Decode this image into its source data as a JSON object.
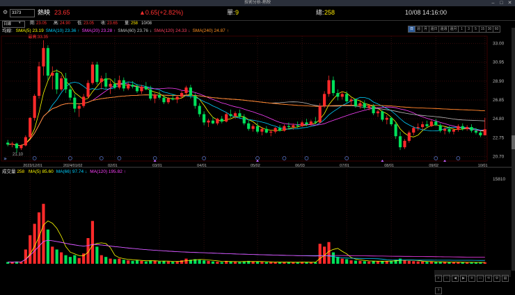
{
  "window": {
    "title": "技術分析-熱映",
    "min": "–",
    "max": "□",
    "close": "✕"
  },
  "info": {
    "code": "3373",
    "name": "熱映",
    "price": "23.65",
    "change": "▲0.65(+2.82%)",
    "unit_label": "單:",
    "unit_value": "9",
    "total_label": "總:",
    "total_value": "258",
    "datetime": "10/08 14:16:00"
  },
  "toolbar": {
    "period": "日線",
    "timeframes": [
      "日",
      "週",
      "月",
      "還日",
      "還週",
      "還月",
      "1",
      "3",
      "5",
      "15",
      "30",
      "60"
    ],
    "active_tf": 0
  },
  "ohlc": {
    "open_label": "開:",
    "open": "23.05",
    "high_label": "高:",
    "high": "24.90",
    "low_label": "低:",
    "low": "23.05",
    "close_label": "收:",
    "close": "23.65",
    "vol_label": "量:",
    "vol": "258",
    "date": "10/08"
  },
  "ma_legend": {
    "title": "均線:",
    "items": [
      {
        "label": "SMA(5) 23.19",
        "color": "#ffff00"
      },
      {
        "label": "SMA(10) 23.36 ↑",
        "color": "#00d0ff"
      },
      {
        "label": "SMA(20) 23.28 ↑",
        "color": "#ff40ff"
      },
      {
        "label": "SMA(60) 23.76 ↓",
        "color": "#c0c0c0"
      },
      {
        "label": "SMA(120) 24.33 ↓",
        "color": "#ff4060"
      },
      {
        "label": "SMA(240) 24.87 ↑",
        "color": "#ff9020"
      }
    ]
  },
  "annotations": {
    "max": "最高:33.35",
    "min": "21.10"
  },
  "vol_legend": {
    "title": "成交量",
    "value": "258",
    "items": [
      {
        "label": "MA(5) 85.60",
        "color": "#ffff00"
      },
      {
        "label": "MA(66) 97.74 ↓",
        "color": "#00d0ff"
      },
      {
        "label": "MA(120) 195.82 ↑",
        "color": "#ff40ff"
      }
    ]
  },
  "y_ticks": [
    "33.00",
    "30.95",
    "28.90",
    "26.85",
    "24.80",
    "22.75",
    "20.70"
  ],
  "x_ticks": [
    "2023/12/01",
    "2024/01/02",
    "02/01",
    "03/01",
    "04/01",
    "05/02",
    "06/03",
    "07/01",
    "08/01",
    "09/02",
    "10/01"
  ],
  "vol_max": "15810",
  "colors": {
    "up": "#ff2a2a",
    "down": "#00e05a",
    "bg": "#000000"
  },
  "chart_data": {
    "type": "candlestick",
    "y_range": [
      20.2,
      33.8
    ],
    "vol_range": [
      0,
      15810
    ],
    "candles": [
      [
        22.2,
        22.5,
        21.8,
        22.0,
        300
      ],
      [
        22.0,
        22.3,
        21.7,
        22.1,
        250
      ],
      [
        22.1,
        22.2,
        21.1,
        21.6,
        400
      ],
      [
        21.6,
        22.0,
        21.4,
        21.9,
        300
      ],
      [
        21.9,
        23.0,
        21.8,
        22.8,
        2500
      ],
      [
        22.8,
        25.0,
        22.7,
        24.9,
        5000
      ],
      [
        24.9,
        27.5,
        24.6,
        27.3,
        7000
      ],
      [
        27.3,
        31.0,
        27.0,
        30.5,
        9000
      ],
      [
        30.5,
        33.35,
        29.5,
        32.5,
        10500
      ],
      [
        32.5,
        32.8,
        29.0,
        29.5,
        6000
      ],
      [
        29.5,
        30.5,
        28.0,
        29.8,
        3000
      ],
      [
        29.8,
        30.2,
        27.5,
        28.0,
        2500
      ],
      [
        28.0,
        29.5,
        27.8,
        29.2,
        2000
      ],
      [
        29.2,
        29.8,
        27.6,
        28.0,
        1500
      ],
      [
        28.0,
        28.5,
        26.8,
        27.1,
        1200
      ],
      [
        27.1,
        27.5,
        25.5,
        25.9,
        1500
      ],
      [
        25.9,
        26.4,
        25.0,
        26.2,
        1000
      ],
      [
        26.2,
        27.5,
        26.0,
        27.2,
        1800
      ],
      [
        27.2,
        29.0,
        27.0,
        28.7,
        4500
      ],
      [
        28.7,
        31.0,
        28.5,
        30.7,
        7500
      ],
      [
        30.7,
        31.0,
        28.5,
        28.8,
        3000
      ],
      [
        28.8,
        29.5,
        28.0,
        29.2,
        1500
      ],
      [
        29.2,
        29.8,
        28.0,
        28.3,
        1200
      ],
      [
        28.3,
        29.0,
        27.5,
        28.6,
        900
      ],
      [
        28.6,
        29.2,
        28.0,
        28.2,
        800
      ],
      [
        28.2,
        29.5,
        28.0,
        29.0,
        900
      ],
      [
        29.0,
        29.3,
        27.8,
        28.1,
        700
      ],
      [
        28.1,
        28.8,
        27.9,
        28.5,
        600
      ],
      [
        28.5,
        28.9,
        28.1,
        28.3,
        500
      ],
      [
        28.3,
        28.6,
        27.6,
        27.8,
        600
      ],
      [
        27.8,
        28.5,
        27.5,
        28.3,
        500
      ],
      [
        28.3,
        28.8,
        27.9,
        28.0,
        400
      ],
      [
        28.0,
        28.4,
        26.8,
        27.0,
        600
      ],
      [
        27.0,
        27.6,
        26.5,
        27.4,
        500
      ],
      [
        27.4,
        27.8,
        26.9,
        27.1,
        400
      ],
      [
        27.1,
        27.4,
        26.4,
        26.6,
        500
      ],
      [
        26.6,
        27.2,
        26.4,
        27.0,
        400
      ],
      [
        27.0,
        27.5,
        26.8,
        26.9,
        350
      ],
      [
        26.9,
        27.3,
        26.5,
        27.2,
        400
      ],
      [
        27.2,
        27.8,
        27.0,
        27.6,
        600
      ],
      [
        27.6,
        28.4,
        27.4,
        28.2,
        900
      ],
      [
        28.2,
        28.5,
        27.0,
        27.3,
        700
      ],
      [
        27.3,
        27.6,
        25.9,
        26.2,
        800
      ],
      [
        26.2,
        26.5,
        25.0,
        25.3,
        700
      ],
      [
        25.3,
        25.6,
        24.1,
        24.4,
        600
      ],
      [
        24.4,
        24.8,
        23.9,
        24.6,
        500
      ],
      [
        24.6,
        25.0,
        24.2,
        24.3,
        400
      ],
      [
        24.3,
        24.9,
        24.1,
        24.8,
        350
      ],
      [
        24.8,
        25.1,
        24.3,
        24.5,
        300
      ],
      [
        24.5,
        25.5,
        24.4,
        25.3,
        500
      ],
      [
        25.3,
        25.8,
        24.9,
        25.1,
        400
      ],
      [
        25.1,
        25.6,
        24.8,
        25.4,
        350
      ],
      [
        25.4,
        25.8,
        24.9,
        25.0,
        300
      ],
      [
        25.0,
        25.3,
        24.1,
        24.3,
        400
      ],
      [
        24.3,
        24.7,
        23.5,
        23.7,
        500
      ],
      [
        23.7,
        24.2,
        23.4,
        24.0,
        400
      ],
      [
        24.0,
        24.4,
        23.2,
        23.4,
        350
      ],
      [
        23.4,
        23.9,
        23.0,
        23.7,
        300
      ],
      [
        23.7,
        24.0,
        23.2,
        23.3,
        280
      ],
      [
        23.3,
        23.6,
        22.9,
        23.4,
        300
      ],
      [
        23.4,
        23.9,
        23.2,
        23.8,
        260
      ],
      [
        23.8,
        24.1,
        23.4,
        23.5,
        240
      ],
      [
        23.5,
        24.2,
        23.4,
        24.0,
        300
      ],
      [
        24.0,
        24.4,
        23.7,
        23.9,
        280
      ],
      [
        23.9,
        24.3,
        23.6,
        24.1,
        260
      ],
      [
        24.1,
        24.5,
        23.8,
        24.0,
        250
      ],
      [
        24.0,
        24.6,
        23.9,
        24.4,
        300
      ],
      [
        24.4,
        24.8,
        24.0,
        24.2,
        280
      ],
      [
        24.2,
        24.7,
        24.0,
        24.5,
        270
      ],
      [
        24.5,
        25.0,
        24.2,
        24.4,
        260
      ],
      [
        24.4,
        26.5,
        24.3,
        26.2,
        3500
      ],
      [
        26.2,
        27.8,
        26.0,
        27.5,
        3000
      ],
      [
        27.5,
        29.5,
        27.2,
        29.0,
        3800
      ],
      [
        29.0,
        29.4,
        27.3,
        27.6,
        2000
      ],
      [
        27.6,
        28.0,
        26.8,
        27.2,
        1200
      ],
      [
        27.2,
        27.8,
        26.9,
        27.5,
        900
      ],
      [
        27.5,
        27.8,
        26.5,
        26.7,
        800
      ],
      [
        26.7,
        27.1,
        26.2,
        26.9,
        600
      ],
      [
        26.9,
        27.0,
        26.0,
        26.2,
        550
      ],
      [
        26.2,
        26.7,
        25.9,
        26.5,
        500
      ],
      [
        26.5,
        26.8,
        25.8,
        26.0,
        450
      ],
      [
        26.0,
        26.4,
        25.7,
        26.2,
        400
      ],
      [
        26.2,
        26.4,
        25.2,
        25.4,
        500
      ],
      [
        25.4,
        25.8,
        25.0,
        25.6,
        400
      ],
      [
        25.6,
        25.7,
        24.5,
        24.7,
        500
      ],
      [
        24.7,
        25.2,
        24.2,
        24.9,
        450
      ],
      [
        24.9,
        25.0,
        24.0,
        24.2,
        500
      ],
      [
        24.2,
        24.5,
        22.6,
        22.9,
        700
      ],
      [
        22.9,
        23.4,
        21.4,
        21.7,
        900
      ],
      [
        21.7,
        22.6,
        21.5,
        22.4,
        600
      ],
      [
        22.4,
        23.5,
        22.2,
        23.3,
        500
      ],
      [
        23.3,
        24.0,
        23.0,
        23.8,
        450
      ],
      [
        23.8,
        24.3,
        23.5,
        23.9,
        400
      ],
      [
        23.9,
        24.5,
        23.6,
        24.2,
        380
      ],
      [
        24.2,
        24.6,
        23.8,
        24.0,
        350
      ],
      [
        24.0,
        24.7,
        23.9,
        24.5,
        360
      ],
      [
        24.5,
        24.8,
        24.0,
        24.1,
        300
      ],
      [
        24.1,
        24.3,
        23.3,
        23.5,
        350
      ],
      [
        23.5,
        23.9,
        23.1,
        23.7,
        300
      ],
      [
        23.7,
        24.0,
        23.2,
        23.4,
        260
      ],
      [
        23.4,
        23.8,
        23.1,
        23.6,
        250
      ],
      [
        23.6,
        24.2,
        23.4,
        24.0,
        280
      ],
      [
        24.0,
        24.3,
        23.5,
        23.7,
        240
      ],
      [
        23.7,
        24.1,
        23.5,
        23.9,
        230
      ],
      [
        23.9,
        24.2,
        23.3,
        23.5,
        250
      ],
      [
        23.5,
        23.8,
        23.1,
        23.3,
        240
      ],
      [
        23.3,
        23.5,
        22.8,
        23.0,
        260
      ],
      [
        23.0,
        24.9,
        23.0,
        23.65,
        258
      ]
    ],
    "series": [
      {
        "name": "SMA(5)",
        "color": "#ffff00"
      },
      {
        "name": "SMA(10)",
        "color": "#00d0ff"
      },
      {
        "name": "SMA(20)",
        "color": "#ff40ff"
      },
      {
        "name": "SMA(60)",
        "color": "#c0c0c0"
      },
      {
        "name": "SMA(120)",
        "color": "#ff4060"
      },
      {
        "name": "SMA(240)",
        "color": "#ff9020"
      }
    ]
  }
}
